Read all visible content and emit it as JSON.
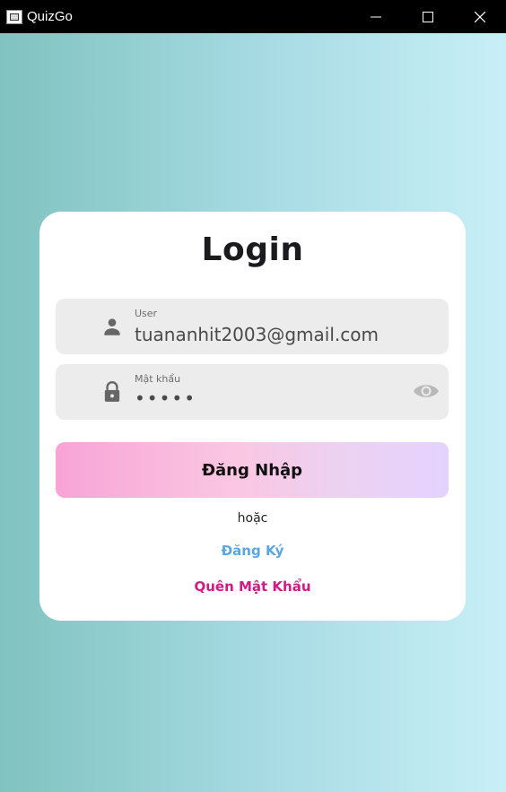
{
  "window": {
    "title": "QuizGo",
    "app_icon": "quizgo-app-icon",
    "controls": [
      "minimize-icon",
      "maximize-icon",
      "close-icon"
    ]
  },
  "login": {
    "title": "Login",
    "user_field": {
      "label": "User",
      "value": "tuananhit2003@gmail.com",
      "icon": "person-icon"
    },
    "password_field": {
      "label": "Mật khẩu",
      "value": "•••••",
      "icon": "lock-icon",
      "toggle_icon": "eye-icon"
    },
    "submit_label": "Đăng Nhập",
    "or_text": "hoặc",
    "register_label": "Đăng Ký",
    "forgot_label": "Quên Mật Khẩu"
  },
  "colors": {
    "titlebar": "#000000",
    "register_link": "#5aa7e0",
    "forgot_link": "#d11a86",
    "field_bg": "#ececec",
    "card_bg": "#ffffff"
  }
}
